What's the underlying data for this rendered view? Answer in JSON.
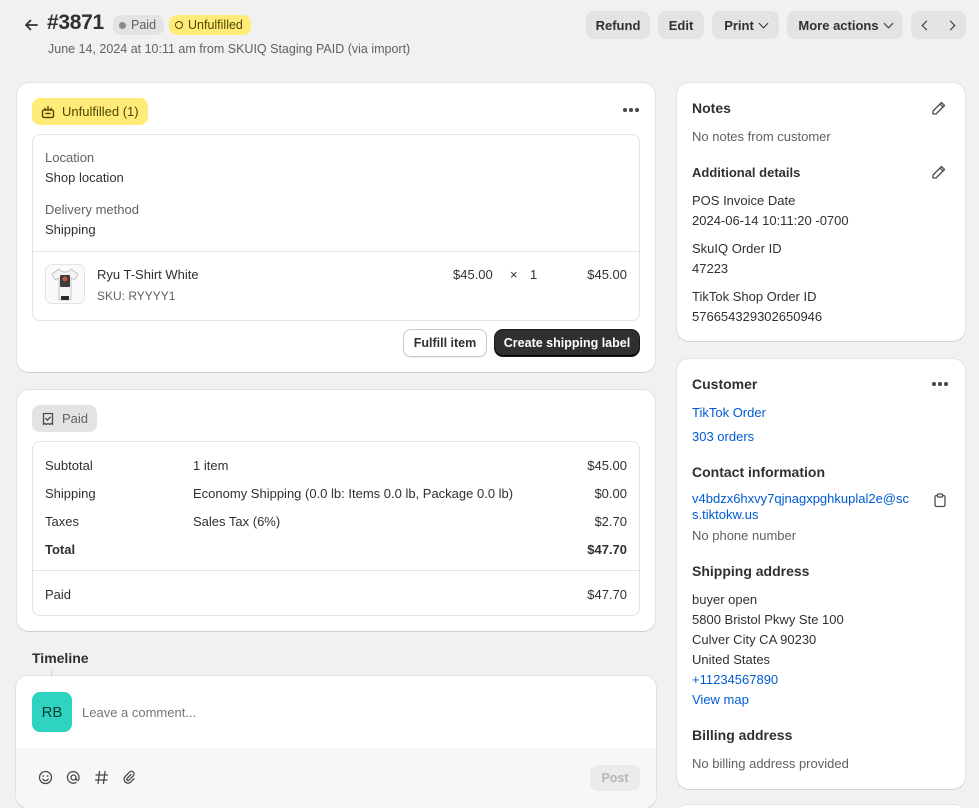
{
  "header": {
    "order_number": "#3871",
    "badge_paid": "Paid",
    "badge_unfulfilled": "Unfulfilled",
    "subtitle": "June 14, 2024 at 10:11 am from SKUIQ Staging PAID (via import)",
    "buttons": {
      "refund": "Refund",
      "edit": "Edit",
      "print": "Print",
      "more_actions": "More actions"
    }
  },
  "fulfillment": {
    "status_label": "Unfulfilled (1)",
    "location_label": "Location",
    "location_value": "Shop location",
    "delivery_label": "Delivery method",
    "delivery_value": "Shipping",
    "item": {
      "name": "Ryu T-Shirt White",
      "sku": "SKU: RYYYY1",
      "price": "$45.00",
      "times": "×",
      "qty": "1",
      "total": "$45.00"
    },
    "fulfill_button": "Fulfill item",
    "shipping_label_button": "Create shipping label"
  },
  "payment": {
    "status_label": "Paid",
    "rows": [
      {
        "label": "Subtotal",
        "desc": "1 item",
        "amount": "$45.00"
      },
      {
        "label": "Shipping",
        "desc": "Economy Shipping (0.0 lb: Items 0.0 lb, Package 0.0 lb)",
        "amount": "$0.00"
      },
      {
        "label": "Taxes",
        "desc": "Sales Tax (6%)",
        "amount": "$2.70"
      },
      {
        "label": "Total",
        "desc": "",
        "amount": "$47.70"
      }
    ],
    "paid_label": "Paid",
    "paid_amount": "$47.70"
  },
  "timeline": {
    "title": "Timeline",
    "avatar_initials": "RB",
    "comment_placeholder": "Leave a comment...",
    "post_button": "Post"
  },
  "notes": {
    "title": "Notes",
    "value": "No notes from customer",
    "additional_title": "Additional details",
    "details": [
      {
        "label": "POS Invoice Date",
        "value": "2024-06-14 10:11:20 -0700"
      },
      {
        "label": "SkuIQ Order ID",
        "value": "47223"
      },
      {
        "label": "TikTok Shop Order ID",
        "value": "576654329302650946"
      }
    ]
  },
  "customer": {
    "title": "Customer",
    "name": "TikTok Order",
    "orders": "303 orders",
    "contact_title": "Contact information",
    "email_line1": "v4bdzx6hxvy7qjnagxpghkuplal2e@sc",
    "email_line2": "s.tiktokw.us",
    "phone": "No phone number",
    "shipping_title": "Shipping address",
    "address": [
      "buyer open",
      "5800 Bristol Pkwy Ste 100",
      "Culver City CA 90230",
      "United States"
    ],
    "address_phone": "+11234567890",
    "view_map": "View map",
    "billing_title": "Billing address",
    "billing_value": "No billing address provided"
  },
  "colors": {
    "accent_link": "#005bd3",
    "badge_unfulfilled_bg": "#ffeb78",
    "avatar_bg": "#2dd4bf",
    "primary_button": "#303030"
  }
}
